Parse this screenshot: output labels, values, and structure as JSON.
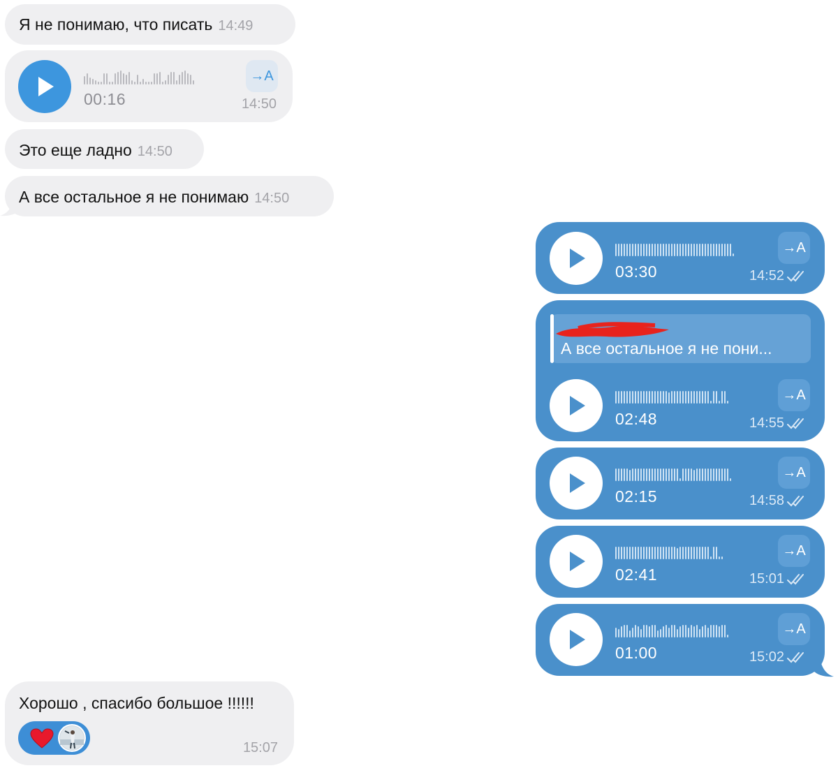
{
  "incoming": {
    "msg1": {
      "text": "Я не понимаю, что писать",
      "time": "14:49"
    },
    "voice1": {
      "duration": "00:16",
      "time": "14:50",
      "transcribe_label": "→A"
    },
    "msg2": {
      "text": "Это еще ладно",
      "time": "14:50"
    },
    "msg3": {
      "text": "А все остальное я не понимаю",
      "time": "14:50"
    },
    "msg4": {
      "text": "Хорошо , спасибо большое !!!!!!",
      "time": "15:07",
      "reaction": "heart"
    }
  },
  "outgoing": [
    {
      "duration": "03:30",
      "time": "14:52",
      "transcribe_label": "→A"
    },
    {
      "duration": "02:48",
      "time": "14:55",
      "transcribe_label": "→A",
      "reply_to_text": "А все остальное я не пони..."
    },
    {
      "duration": "02:15",
      "time": "14:58",
      "transcribe_label": "→A"
    },
    {
      "duration": "02:41",
      "time": "15:01",
      "transcribe_label": "→A"
    },
    {
      "duration": "01:00",
      "time": "15:02",
      "transcribe_label": "→A"
    }
  ],
  "colors": {
    "incoming_bubble": "#efeff1",
    "outgoing_bubble": "#4a90cb",
    "accent": "#3d96de",
    "reaction_pill": "#3d8ed6",
    "heart": "#e8192c",
    "redaction": "#e8231d"
  },
  "icons": [
    "play-icon",
    "transcribe-icon",
    "double-check-icon",
    "heart-icon"
  ]
}
